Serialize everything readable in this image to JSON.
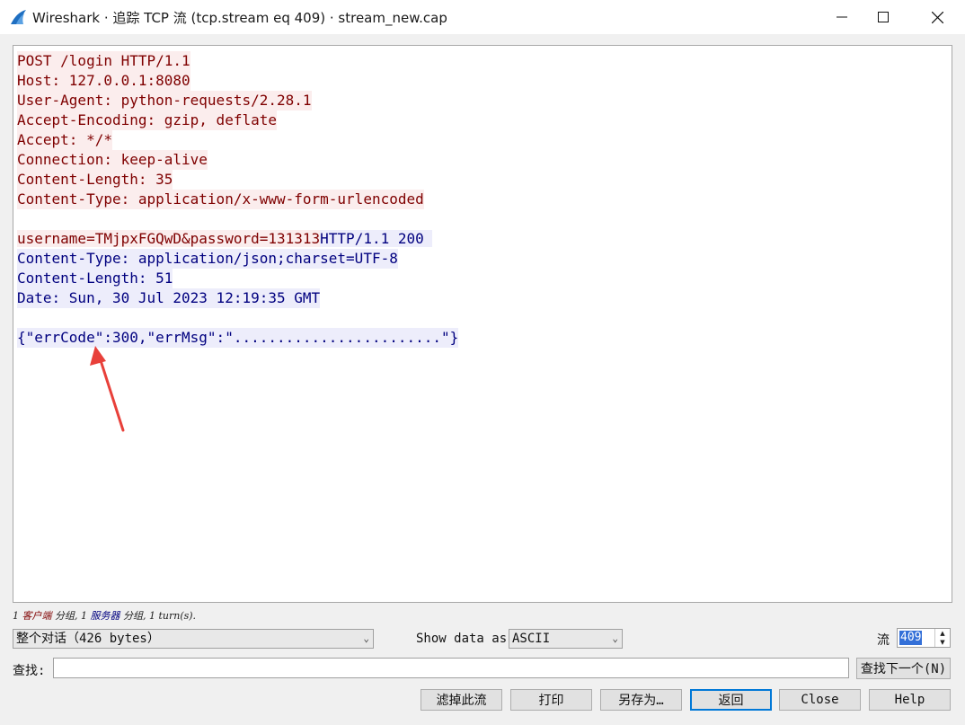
{
  "window": {
    "title": "Wireshark · 追踪 TCP 流 (tcp.stream eq 409) · stream_new.cap",
    "icon": "wireshark-fin-icon",
    "controls": [
      "minimize-icon",
      "maximize-icon",
      "close-icon"
    ]
  },
  "colors": {
    "client_fg": "#7f0000",
    "client_bg": "#fbeded",
    "server_fg": "#00007f",
    "server_bg": "#ededfb",
    "annotation_arrow": "#e8403a"
  },
  "stream": {
    "client_lines": [
      "POST /login HTTP/1.1",
      "Host: 127.0.0.1:8080",
      "User-Agent: python-requests/2.28.1",
      "Accept-Encoding: gzip, deflate",
      "Accept: */*",
      "Connection: keep-alive",
      "Content-Length: 35",
      "Content-Type: application/x-www-form-urlencoded"
    ],
    "client_body": "username=TMjpxFGQwD&password=131313",
    "server_status": "HTTP/1.1 200 ",
    "server_lines": [
      "Content-Type: application/json;charset=UTF-8",
      "Content-Length: 51",
      "Date: Sun, 30 Jul 2023 12:19:35 GMT"
    ],
    "server_body": "{\"errCode\":300,\"errMsg\":\"........................\"}"
  },
  "status": {
    "count1": "1 ",
    "client_word": "客户端",
    "mid1": " 分组, 1 ",
    "server_word": "服务器",
    "mid2": " 分组, 1 turn(s)."
  },
  "controls": {
    "conversation_select": "整个对话（426 bytes）",
    "show_data_label": "Show data as",
    "show_data_select": "ASCII",
    "stream_label": "流",
    "stream_value": "409",
    "find_label": "查找:",
    "find_value": "",
    "find_next_button": "查找下一个(N)"
  },
  "buttons": {
    "filter_out": "滤掉此流",
    "print": "打印",
    "save_as": "另存为…",
    "back": "返回",
    "close": "Close",
    "help": "Help"
  }
}
